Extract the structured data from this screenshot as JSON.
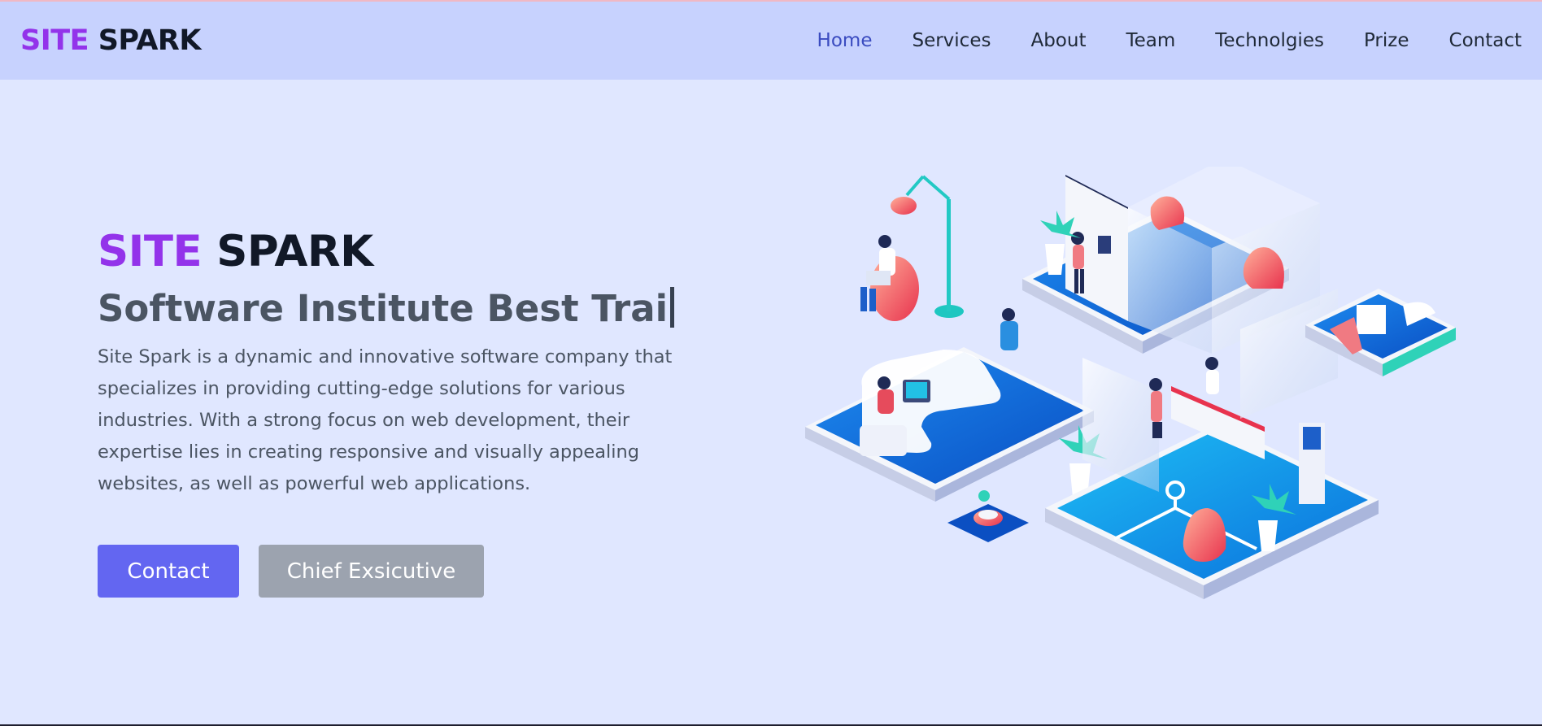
{
  "header": {
    "logo_part1": "SITE",
    "logo_part2": "SPARK",
    "nav": [
      "Home",
      "Services",
      "About",
      "Team",
      "Technolgies",
      "Prize",
      "Contact"
    ],
    "active_nav": "Home"
  },
  "hero": {
    "title_part1": "SITE",
    "title_part2": "SPARK",
    "subtitle": "Software Institute Best Trai",
    "description": "Site Spark is a dynamic and innovative software company that specializes in providing cutting-edge solutions for various industries. With a strong focus on web development, their expertise lies in creating responsive and visually appealing websites, as well as powerful web applications.",
    "primary_button": "Contact",
    "secondary_button": "Chief Exsicutive"
  },
  "colors": {
    "header_bg": "#c7d2fe",
    "page_bg": "#e0e7ff",
    "brand_purple": "#9333ea",
    "primary_button": "#6366f1",
    "secondary_button": "#9ca3af"
  },
  "illustration": {
    "name": "isometric-office-illustration"
  }
}
